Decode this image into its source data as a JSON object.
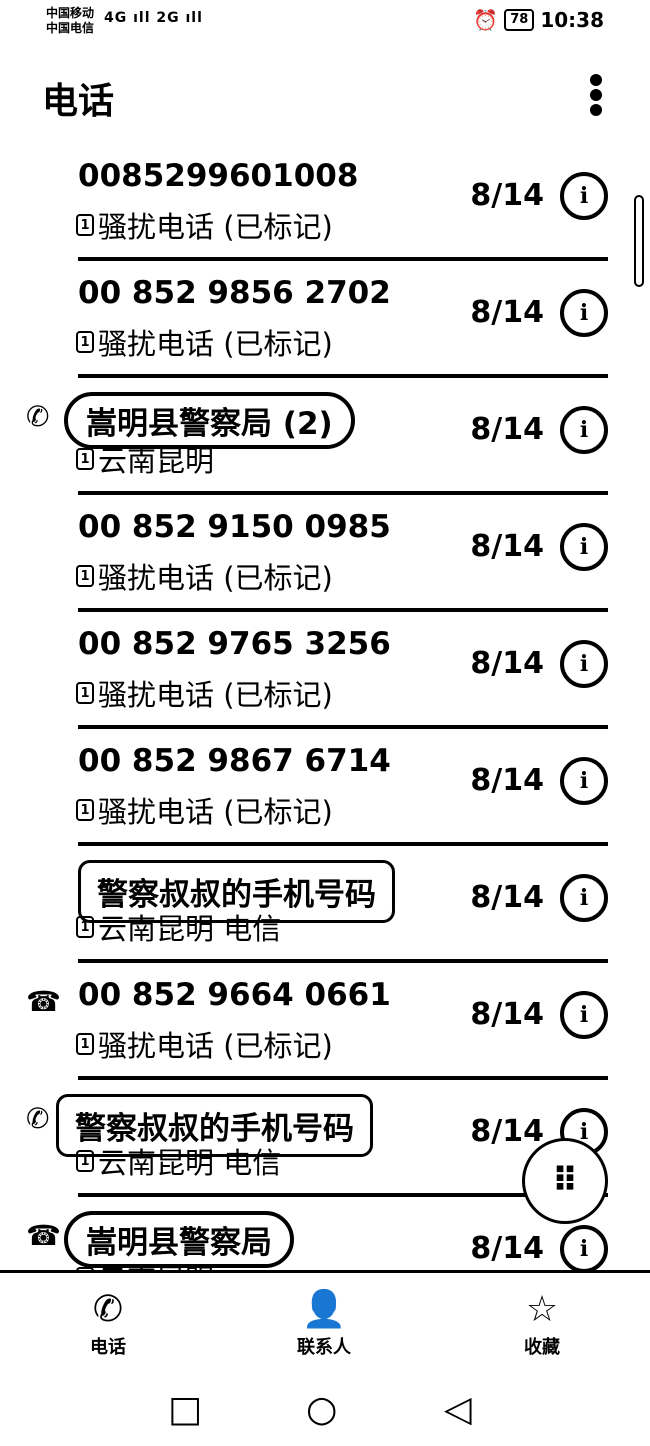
{
  "status_bar": {
    "carrier1": "中国移动",
    "carrier2": "中国电信",
    "signal": "4G ıll 2G ıll",
    "alarm_icon": "alarm-icon",
    "battery": "78",
    "time": "10:38"
  },
  "header": {
    "title": "电话"
  },
  "calls": [
    {
      "name": "0085299601008",
      "sub": "骚扰电话 (已标记)",
      "date": "8/14",
      "type_icon": ""
    },
    {
      "name": "00 852 9856 2702",
      "sub": "骚扰电话 (已标记)",
      "date": "8/14",
      "type_icon": ""
    },
    {
      "name": "嵩明县警察局 (2)",
      "sub": "云南昆明",
      "date": "8/14",
      "type_icon": "✆"
    },
    {
      "name": "00 852 9150 0985",
      "sub": "骚扰电话 (已标记)",
      "date": "8/14",
      "type_icon": ""
    },
    {
      "name": "00 852 9765 3256",
      "sub": "骚扰电话 (已标记)",
      "date": "8/14",
      "type_icon": ""
    },
    {
      "name": "00 852 9867 6714",
      "sub": "骚扰电话 (已标记)",
      "date": "8/14",
      "type_icon": ""
    },
    {
      "name": "警察叔叔的手机号码",
      "sub": "云南昆明 电信",
      "date": "8/14",
      "type_icon": ""
    },
    {
      "name": "00 852 9664 0661",
      "sub": "骚扰电话 (已标记)",
      "date": "8/14",
      "type_icon": "☎"
    },
    {
      "name": "警察叔叔的手机号码",
      "sub": "云南昆明 电信",
      "date": "8/14",
      "type_icon": "✆"
    },
    {
      "name": "嵩明县警察局",
      "sub": "云南昆明",
      "date": "8/14",
      "type_icon": "☎"
    }
  ],
  "sim_badge": "1",
  "info_glyph": "i",
  "fab": {
    "icon": "dialpad-icon",
    "glyph": "⠿"
  },
  "bottom_nav": {
    "phone": "电话",
    "contacts": "联系人",
    "favorites": "收藏"
  },
  "system_nav": {
    "square": "□",
    "circle": "○",
    "back": "◁"
  }
}
